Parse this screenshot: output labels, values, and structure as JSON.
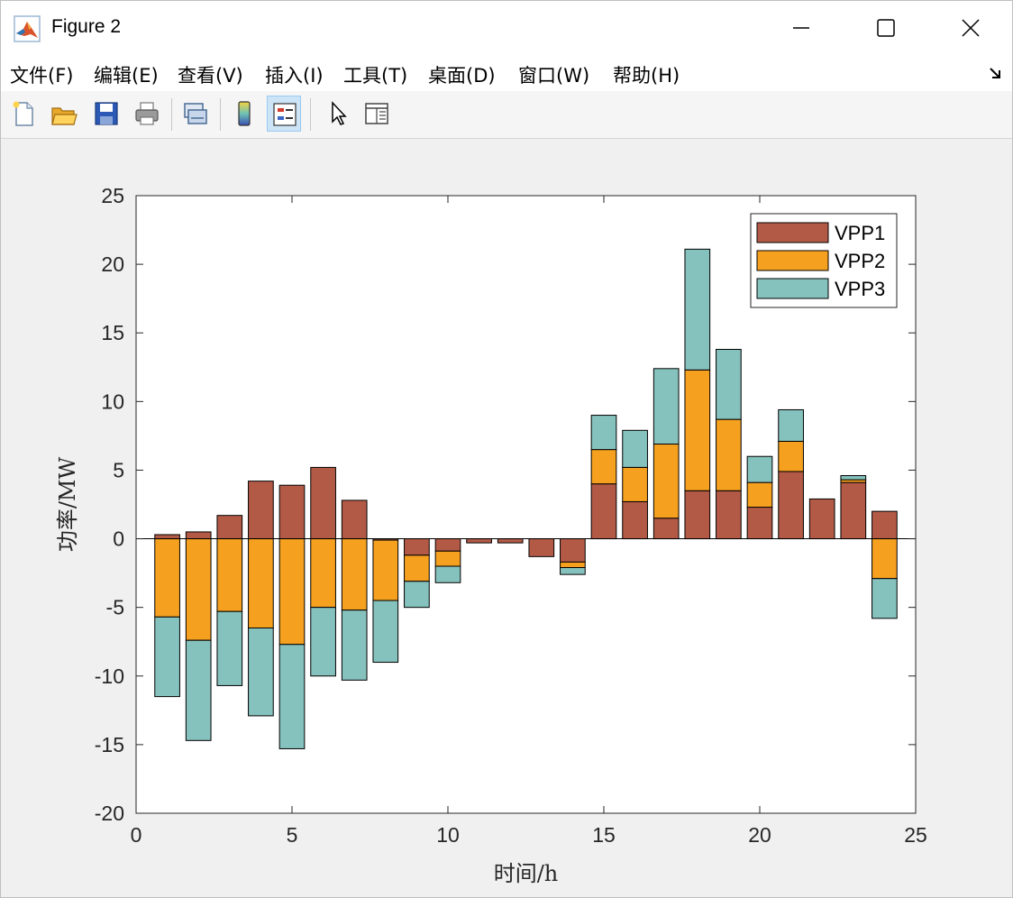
{
  "window": {
    "title": "Figure 2"
  },
  "menu": {
    "items": [
      "文件(F)",
      "编辑(E)",
      "查看(V)",
      "插入(I)",
      "工具(T)",
      "桌面(D)",
      "窗口(W)",
      "帮助(H)"
    ]
  },
  "toolbar": {
    "buttons": [
      "new-figure-icon",
      "open-file-icon",
      "save-icon",
      "print-icon",
      "link-plot-icon",
      "colorbar-icon",
      "legend-icon",
      "pointer-icon",
      "property-inspector-icon"
    ]
  },
  "colors": {
    "VPP1": "#b35a47",
    "VPP2": "#f5a01f",
    "VPP3": "#85c1bd"
  },
  "chart_data": {
    "type": "bar",
    "stacked": true,
    "title": "",
    "xlabel": "时间/h",
    "ylabel": "功率/MW",
    "xlim": [
      0,
      25
    ],
    "ylim": [
      -20,
      25
    ],
    "xticks": [
      0,
      5,
      10,
      15,
      20,
      25
    ],
    "yticks": [
      -20,
      -15,
      -10,
      -5,
      0,
      5,
      10,
      15,
      20,
      25
    ],
    "legend_position": "top-right",
    "x": [
      1,
      2,
      3,
      4,
      5,
      6,
      7,
      8,
      9,
      10,
      11,
      12,
      13,
      14,
      15,
      16,
      17,
      18,
      19,
      20,
      21,
      22,
      23,
      24
    ],
    "series": [
      {
        "name": "VPP1",
        "values": [
          0.3,
          0.5,
          1.7,
          4.2,
          3.9,
          5.2,
          2.8,
          -0.1,
          -1.2,
          -0.9,
          -0.3,
          -0.3,
          -1.3,
          -1.7,
          4.0,
          2.7,
          1.5,
          3.5,
          3.5,
          2.3,
          4.9,
          2.9,
          4.1,
          2.0
        ]
      },
      {
        "name": "VPP2",
        "values": [
          -5.7,
          -7.4,
          -5.3,
          -6.5,
          -7.7,
          -5.0,
          -5.2,
          -4.4,
          -1.9,
          -1.1,
          0,
          0,
          0,
          -0.4,
          2.5,
          2.5,
          5.4,
          8.8,
          5.2,
          1.8,
          2.2,
          0,
          0.2,
          -2.9
        ]
      },
      {
        "name": "VPP3",
        "values": [
          -5.8,
          -7.3,
          -5.4,
          -6.4,
          -7.6,
          -5.0,
          -5.1,
          -4.5,
          -1.9,
          -1.2,
          0,
          0,
          0,
          -0.5,
          2.5,
          2.7,
          5.5,
          8.8,
          5.1,
          1.9,
          2.3,
          0,
          0.3,
          -2.9
        ]
      }
    ]
  }
}
